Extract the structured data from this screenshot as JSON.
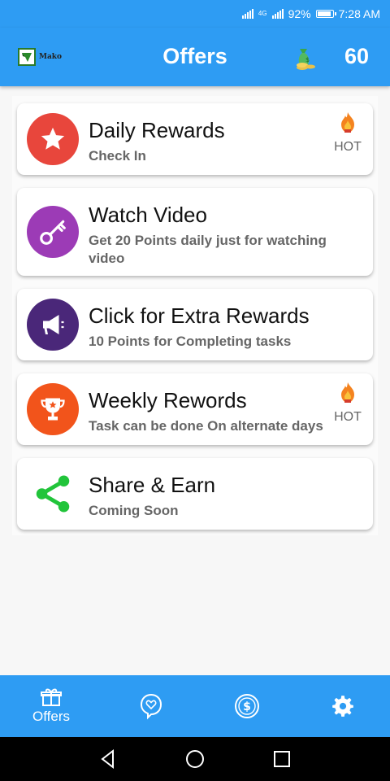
{
  "status_bar": {
    "network": "4G",
    "battery": "92%",
    "time": "7:28 AM"
  },
  "app_bar": {
    "logo_text": "Mako",
    "title": "Offers",
    "points": "60",
    "coins_icon": "money-bag-icon"
  },
  "offers": [
    {
      "title": "Daily Rewards",
      "subtitle": "Check In",
      "icon": "star-icon",
      "color": "#e8463c",
      "hot": "HOT"
    },
    {
      "title": "Watch Video",
      "subtitle": "Get 20 Points daily just for watching video",
      "icon": "key-icon",
      "color": "#9c3bb6"
    },
    {
      "title": "Click for Extra Rewards",
      "subtitle": "10 Points for Completing tasks",
      "icon": "megaphone-icon",
      "color": "#4a2779"
    },
    {
      "title": "Weekly Rewords",
      "subtitle": "Task can be done On alternate days",
      "icon": "trophy-icon",
      "color": "#f2541b",
      "hot": "HOT"
    },
    {
      "title": "Share & Earn",
      "subtitle": "Coming Soon",
      "icon": "share-icon",
      "color": "#21c43a"
    }
  ],
  "bottom_nav": {
    "items": [
      {
        "label": "Offers",
        "icon": "gift-icon",
        "active": true
      },
      {
        "label": "",
        "icon": "chat-heart-icon"
      },
      {
        "label": "",
        "icon": "dollar-coin-icon"
      },
      {
        "label": "",
        "icon": "gear-icon"
      }
    ]
  },
  "colors": {
    "primary": "#2e9cf3",
    "text": "#111111",
    "subtext": "#666666"
  }
}
